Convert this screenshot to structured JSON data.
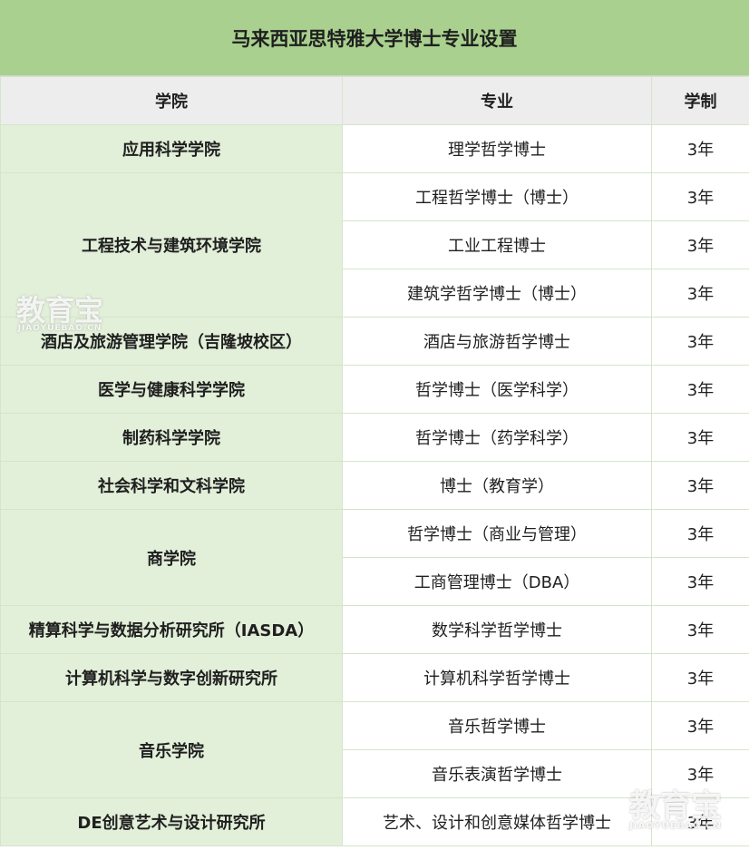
{
  "title": "马来西亚思特雅大学博士专业设置",
  "headers": {
    "college": "学院",
    "major": "专业",
    "duration": "学制"
  },
  "groups": [
    {
      "college": "应用科学学院",
      "majors": [
        {
          "name": "理学哲学博士",
          "duration": "3年"
        }
      ]
    },
    {
      "college": "工程技术与建筑环境学院",
      "majors": [
        {
          "name": "工程哲学博士（博士）",
          "duration": "3年"
        },
        {
          "name": "工业工程博士",
          "duration": "3年"
        },
        {
          "name": "建筑学哲学博士（博士）",
          "duration": "3年"
        }
      ]
    },
    {
      "college": "酒店及旅游管理学院（吉隆坡校区）",
      "majors": [
        {
          "name": "酒店与旅游哲学博士",
          "duration": "3年"
        }
      ]
    },
    {
      "college": "医学与健康科学学院",
      "majors": [
        {
          "name": "哲学博士（医学科学）",
          "duration": "3年"
        }
      ]
    },
    {
      "college": "制药科学学院",
      "majors": [
        {
          "name": "哲学博士（药学科学）",
          "duration": "3年"
        }
      ]
    },
    {
      "college": "社会科学和文科学院",
      "majors": [
        {
          "name": "博士（教育学）",
          "duration": "3年"
        }
      ]
    },
    {
      "college": "商学院",
      "majors": [
        {
          "name": "哲学博士（商业与管理）",
          "duration": "3年"
        },
        {
          "name": "工商管理博士（DBA）",
          "duration": "3年"
        }
      ]
    },
    {
      "college": "精算科学与数据分析研究所（IASDA）",
      "majors": [
        {
          "name": "数学科学哲学博士",
          "duration": "3年"
        }
      ]
    },
    {
      "college": "计算机科学与数字创新研究所",
      "majors": [
        {
          "name": "计算机科学哲学博士",
          "duration": "3年"
        }
      ]
    },
    {
      "college": "音乐学院",
      "majors": [
        {
          "name": "音乐哲学博士",
          "duration": "3年"
        },
        {
          "name": "音乐表演哲学博士",
          "duration": "3年"
        }
      ]
    },
    {
      "college": "DE创意艺术与设计研究所",
      "majors": [
        {
          "name": "艺术、设计和创意媒体哲学博士",
          "duration": "3年"
        }
      ]
    }
  ],
  "watermark": {
    "text": "教育宝",
    "sub": "JIAOYUEBAO.CN"
  },
  "colors": {
    "title_bg": "#a9d08e",
    "header_bg": "#ededed",
    "college_bg": "#e2efd9",
    "border": "#d6e4cc"
  }
}
